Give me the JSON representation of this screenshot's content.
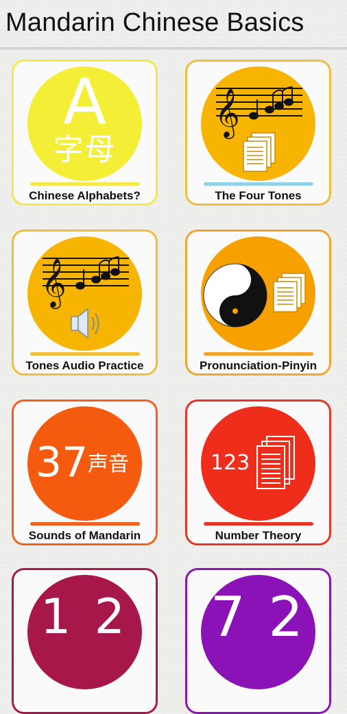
{
  "header": {
    "title": "Mandarin Chinese Basics"
  },
  "colors": {
    "yellow": "#f5ee37",
    "yellow_border": "#f3e94c",
    "amber": "#f7b400",
    "amber_border": "#f0be3a",
    "orange": "#f7a100",
    "orange_border": "#f2a52a",
    "red_orange": "#f45b0f",
    "red_orange_border": "#f0601e",
    "red": "#ee2d1b",
    "red_border": "#e63426",
    "crimson": "#a8174a",
    "purple": "#8a12b6"
  },
  "tiles": [
    {
      "label": "Chinese Alphabets?",
      "glyph": "A",
      "chinese": "字母",
      "icon": "alphabet-icon"
    },
    {
      "label": "The Four Tones",
      "icon": "music-notes-document-icon"
    },
    {
      "label": "Tones Audio Practice",
      "icon": "music-notes-speaker-icon"
    },
    {
      "label": "Pronunciation-Pinyin",
      "icon": "yin-yang-document-icon"
    },
    {
      "label": "Sounds of Mandarin",
      "number": "37",
      "chinese": "声音",
      "icon": "sounds-count-icon"
    },
    {
      "label": "Number Theory",
      "number": "123",
      "icon": "numbers-document-icon"
    },
    {
      "label": "",
      "glyph": "1 2",
      "icon": "numbers-partial-icon"
    },
    {
      "label": "",
      "glyph": "7 2",
      "icon": "numbers-partial-icon"
    }
  ]
}
